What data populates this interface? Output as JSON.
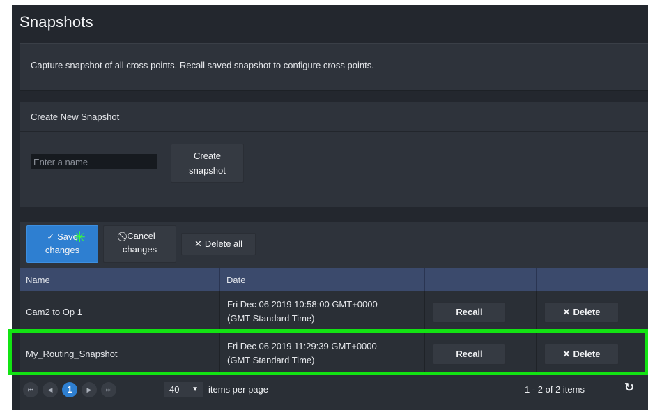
{
  "page": {
    "title": "Snapshots"
  },
  "description": "Capture snapshot of all cross points. Recall saved snapshot to configure cross points.",
  "create": {
    "header": "Create New Snapshot",
    "input_placeholder": "Enter a name",
    "button_line1": "Create",
    "button_line2": "snapshot"
  },
  "toolbar": {
    "save_line1": "Save",
    "save_line2": "changes",
    "cancel_line1": "Cancel",
    "cancel_line2": "changes",
    "delete_all": "Delete all"
  },
  "table": {
    "columns": [
      "Name",
      "Date",
      "",
      ""
    ],
    "rows": [
      {
        "name": "Cam2 to Op 1",
        "date_line1": "Fri Dec 06 2019 10:58:00 GMT+0000",
        "date_line2": "(GMT Standard Time)",
        "recall": "Recall",
        "delete": "Delete"
      },
      {
        "name": "My_Routing_Snapshot",
        "date_line1": "Fri Dec 06 2019 11:29:39 GMT+0000",
        "date_line2": "(GMT Standard Time)",
        "recall": "Recall",
        "delete": "Delete"
      }
    ]
  },
  "pager": {
    "current_page": "1",
    "page_size": "40",
    "per_page_label": "items per page",
    "items_count": "1 - 2 of 2 items"
  },
  "icons": {
    "first": "first-page-icon",
    "prev": "prev-page-icon",
    "next": "next-page-icon",
    "last": "last-page-icon",
    "refresh": "refresh-icon",
    "check": "check-icon",
    "cancel": "ban-icon",
    "delete": "x-icon"
  },
  "colors": {
    "background": "#23272e",
    "panel": "#2e333b",
    "header_row": "#3b4a6c",
    "accent": "#2e7fd1",
    "highlight": "#13e313"
  }
}
